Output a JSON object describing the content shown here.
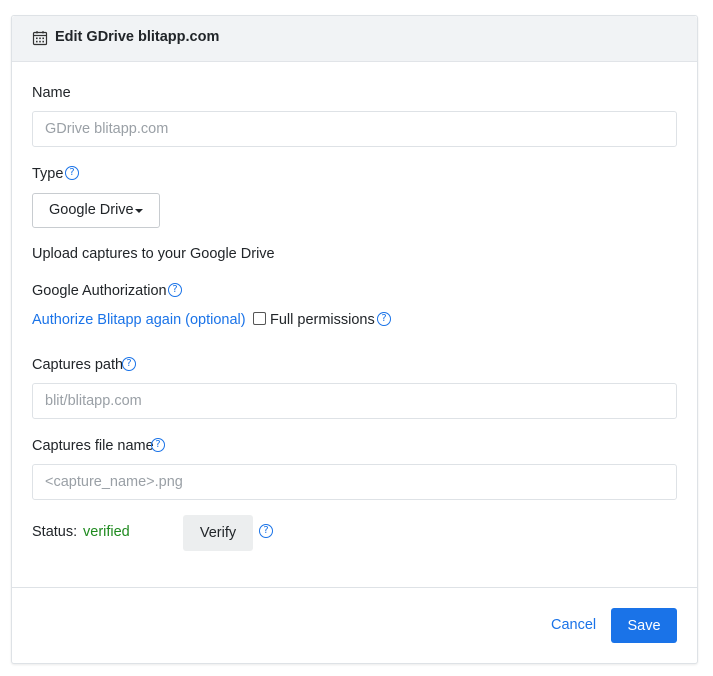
{
  "header": {
    "title": "Edit GDrive blitapp.com",
    "icon": "calendar-icon"
  },
  "form": {
    "name": {
      "label": "Name",
      "placeholder": "GDrive blitapp.com",
      "value": ""
    },
    "type": {
      "label": "Type",
      "selected": "Google Drive",
      "description": "Upload captures to your Google Drive"
    },
    "google_auth": {
      "label": "Google Authorization",
      "authorize_link": "Authorize Blitapp again (optional)",
      "full_permissions_label": "Full permissions",
      "full_permissions_checked": false
    },
    "captures_path": {
      "label": "Captures path",
      "placeholder": "blit/blitapp.com",
      "value": ""
    },
    "captures_file_name": {
      "label": "Captures file name",
      "placeholder": "<capture_name>.png",
      "value": ""
    },
    "status": {
      "label": "Status:",
      "value": "verified",
      "verify_label": "Verify"
    }
  },
  "footer": {
    "cancel_label": "Cancel",
    "save_label": "Save"
  },
  "colors": {
    "accent": "#1a73e8",
    "status_ok": "#1e8a1e",
    "header_bg": "#f1f3f5"
  },
  "help_glyph": "?"
}
